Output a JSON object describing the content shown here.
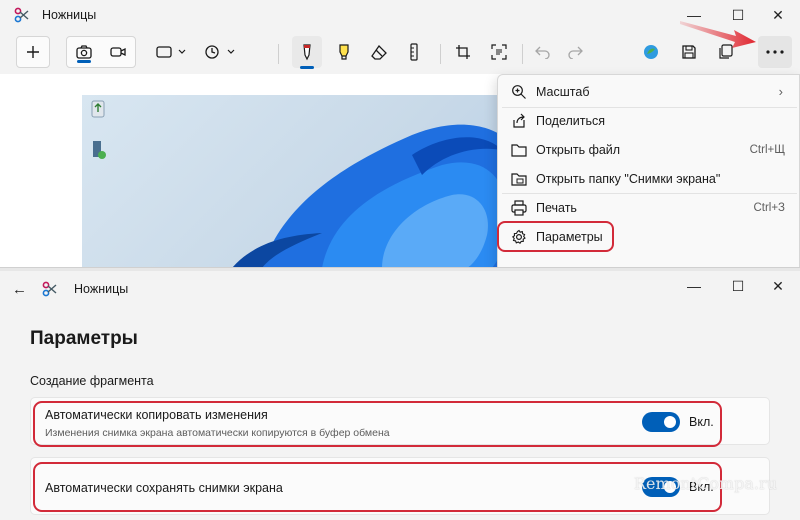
{
  "window1": {
    "title": "Ножницы",
    "menu": {
      "items": [
        {
          "label": "Масштаб",
          "shortcut": "",
          "submenu": true,
          "icon": "zoom-icon"
        },
        {
          "label": "Поделиться",
          "shortcut": "",
          "submenu": false,
          "icon": "share-icon"
        },
        {
          "label": "Открыть файл",
          "shortcut": "Ctrl+Щ",
          "submenu": false,
          "icon": "folder-icon"
        },
        {
          "label": "Открыть папку \"Снимки экрана\"",
          "shortcut": "",
          "submenu": false,
          "icon": "folder-screenshots-icon"
        },
        {
          "label": "Печать",
          "shortcut": "Ctrl+З",
          "submenu": false,
          "icon": "printer-icon"
        },
        {
          "label": "Параметры",
          "shortcut": "",
          "submenu": false,
          "icon": "gear-icon"
        }
      ]
    }
  },
  "window2": {
    "title": "Ножницы",
    "page_title": "Параметры",
    "section_title": "Создание фрагмента",
    "settings": [
      {
        "title": "Автоматически копировать изменения",
        "description": "Изменения снимка экрана автоматически копируются в буфер обмена",
        "toggle_on": true,
        "toggle_label": "Вкл."
      },
      {
        "title": "Автоматически сохранять снимки экрана",
        "description": "",
        "toggle_on": true,
        "toggle_label": "Вкл."
      }
    ]
  },
  "colors": {
    "accent": "#005fb8",
    "highlight": "#d22a39",
    "arrow": "#e0262f"
  },
  "watermark": "RemontCompa.ru"
}
